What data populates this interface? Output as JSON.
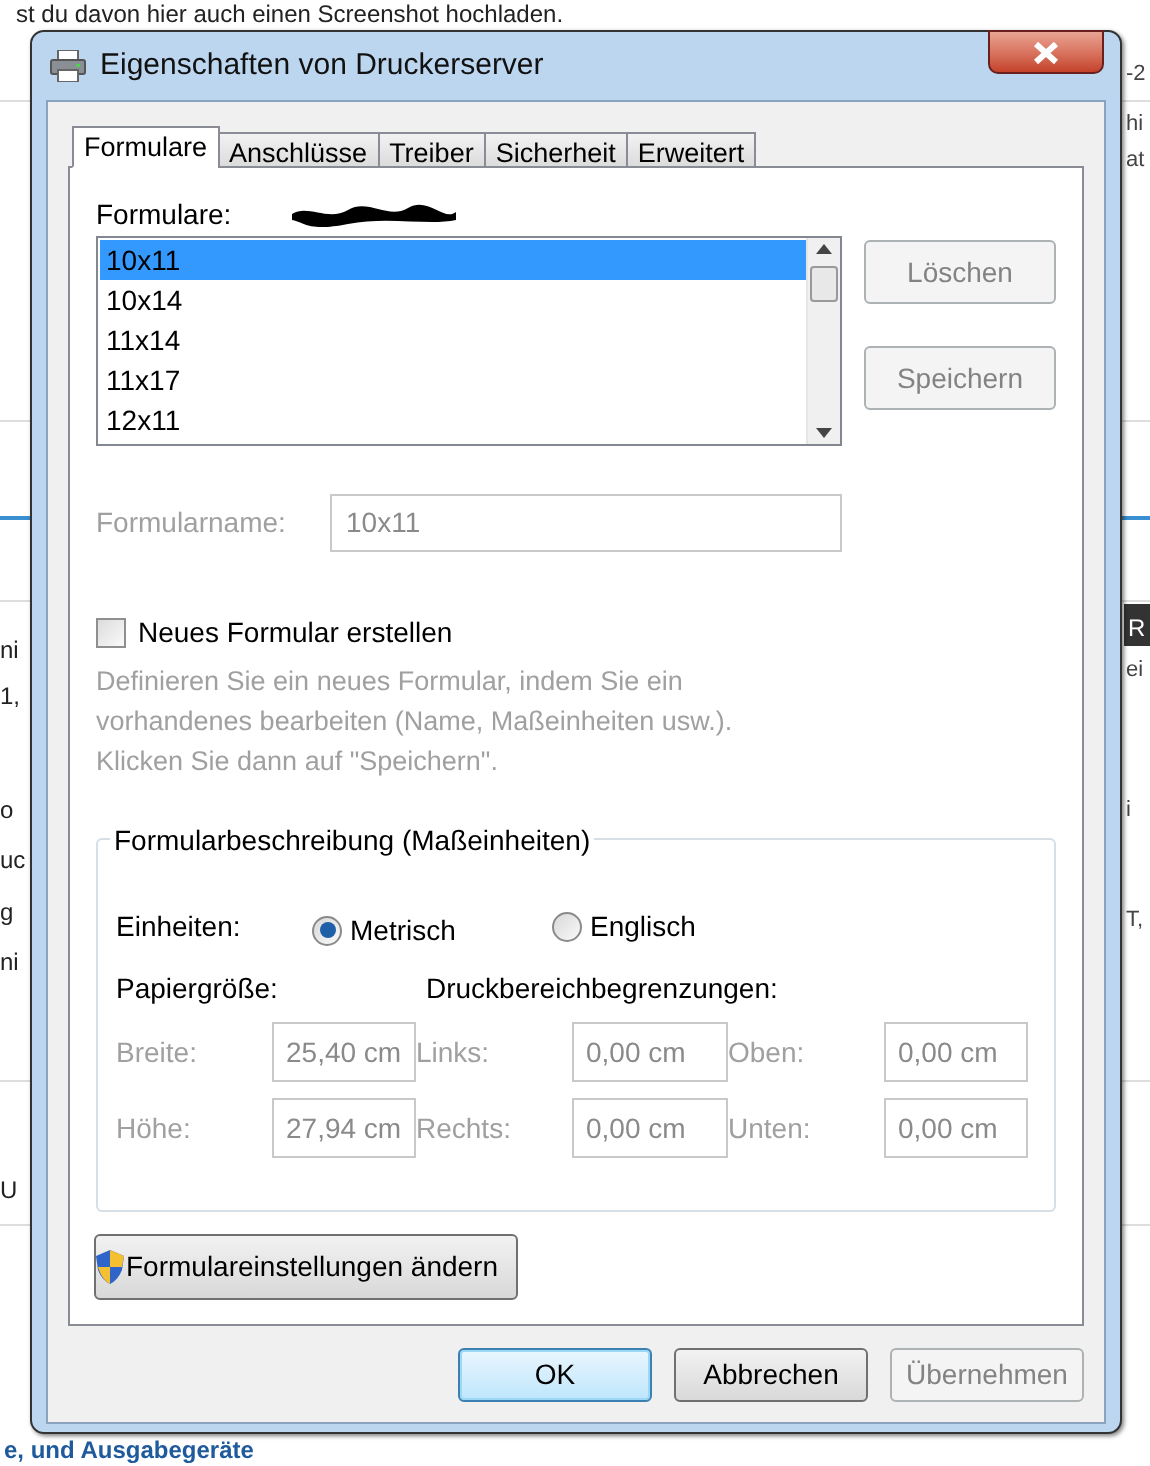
{
  "background": {
    "heading": "st du davon hier auch einen Screenshot hochladen.",
    "left_fragments": [
      {
        "text": "ni"
      },
      {
        "text": "1,"
      },
      {
        "text": "o"
      },
      {
        "text": "uc"
      },
      {
        "text": "g"
      },
      {
        "text": "ni"
      },
      {
        "text": "U"
      }
    ],
    "right_fragments": [
      {
        "text": "-2"
      },
      {
        "text": "hi"
      },
      {
        "text": "at"
      },
      {
        "text": "ei"
      },
      {
        "text": "i"
      },
      {
        "text": "T,"
      }
    ],
    "right_badge": "R",
    "footer_link": "e, und Ausgabegeräte"
  },
  "window": {
    "title": "Eigenschaften von Druckerserver"
  },
  "tabs": [
    {
      "label": "Formulare",
      "selected": true
    },
    {
      "label": "Anschlüsse",
      "selected": false
    },
    {
      "label": "Treiber",
      "selected": false
    },
    {
      "label": "Sicherheit",
      "selected": false
    },
    {
      "label": "Erweitert",
      "selected": false
    }
  ],
  "forms": {
    "label": "Formulare:",
    "items": [
      {
        "label": "10x11",
        "selected": true
      },
      {
        "label": "10x14",
        "selected": false
      },
      {
        "label": "11x14",
        "selected": false
      },
      {
        "label": "11x17",
        "selected": false
      },
      {
        "label": "12x11",
        "selected": false
      }
    ]
  },
  "side_buttons": [
    {
      "label": "Löschen",
      "disabled": true
    },
    {
      "label": "Speichern",
      "disabled": true
    }
  ],
  "form_name": {
    "label": "Formularname:",
    "value": "10x11",
    "disabled": true
  },
  "new_form": {
    "label": "Neues Formular erstellen",
    "checked": false
  },
  "description": "Definieren Sie ein neues Formular, indem Sie ein\nvorhandenes bearbeiten (Name, Maßeinheiten usw.).\nKlicken Sie dann auf \"Speichern\".",
  "group": {
    "legend": "Formularbeschreibung (Maßeinheiten)",
    "units_label": "Einheiten:",
    "units": [
      {
        "label": "Metrisch",
        "selected": true
      },
      {
        "label": "Englisch",
        "selected": false
      }
    ],
    "paper_size_label": "Papiergröße:",
    "margins_label": "Druckbereichbegrenzungen:",
    "fields_disabled": true,
    "fields": [
      {
        "label": "Breite:",
        "value": "25,40 cm"
      },
      {
        "label": "Links:",
        "value": "0,00 cm"
      },
      {
        "label": "Oben:",
        "value": "0,00 cm"
      },
      {
        "label": "Höhe:",
        "value": "27,94 cm"
      },
      {
        "label": "Rechts:",
        "value": "0,00 cm"
      },
      {
        "label": "Unten:",
        "value": "0,00 cm"
      }
    ]
  },
  "change_settings_button": "Formulareinstellungen ändern",
  "dialog_buttons": [
    {
      "label": "OK",
      "kind": "default"
    },
    {
      "label": "Abbrechen",
      "kind": "normal"
    },
    {
      "label": "Übernehmen",
      "kind": "disabled"
    }
  ]
}
